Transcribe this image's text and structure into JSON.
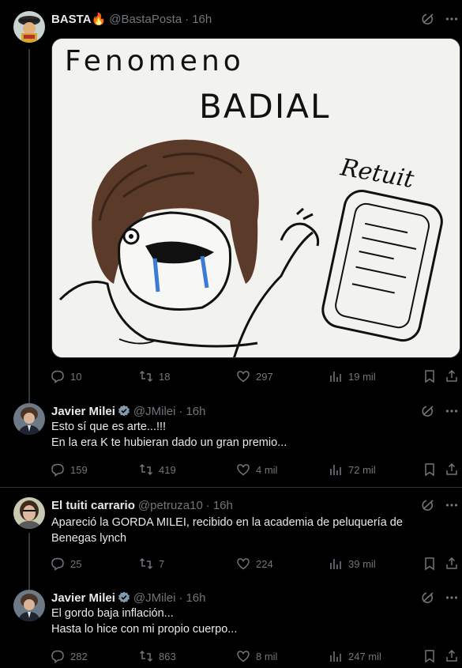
{
  "tweets": [
    {
      "name": "BASTA🔥",
      "handle": "@BastaPosta",
      "time": "16h",
      "verified": false,
      "text": [],
      "media": {
        "lines": [
          "Fenomeno",
          "BADIAL",
          "Retuit"
        ]
      },
      "stats": {
        "replies": "10",
        "retweets": "18",
        "likes": "297",
        "views": "19 mil"
      }
    },
    {
      "name": "Javier Milei",
      "handle": "@JMilei",
      "time": "16h",
      "verified": true,
      "text": [
        "Esto sí que es arte...!!!",
        "En la era K te hubieran dado un gran premio..."
      ],
      "stats": {
        "replies": "159",
        "retweets": "419",
        "likes": "4 mil",
        "views": "72 mil"
      }
    },
    {
      "name": "El tuiti carrario",
      "handle": "@petruza10",
      "time": "16h",
      "verified": false,
      "text": [
        "Apareció la GORDA MILEI, recibido en la academia de peluquería de",
        "Benegas lynch"
      ],
      "stats": {
        "replies": "25",
        "retweets": "7",
        "likes": "224",
        "views": "39 mil"
      }
    },
    {
      "name": "Javier Milei",
      "handle": "@JMilei",
      "time": "16h",
      "verified": true,
      "text": [
        "El gordo baja inflación...",
        "Hasta lo hice con mi propio cuerpo..."
      ],
      "stats": {
        "replies": "282",
        "retweets": "863",
        "likes": "8 mil",
        "views": "247 mil"
      }
    }
  ],
  "colors": {
    "background": "#000000",
    "text": "#e7e9ea",
    "muted": "#71767b",
    "verified": "#829aab",
    "thread_line": "#333639"
  },
  "icons": [
    "grok-icon",
    "more-icon",
    "reply-icon",
    "retweet-icon",
    "like-icon",
    "views-icon",
    "bookmark-icon",
    "share-icon",
    "verified-badge-icon"
  ]
}
